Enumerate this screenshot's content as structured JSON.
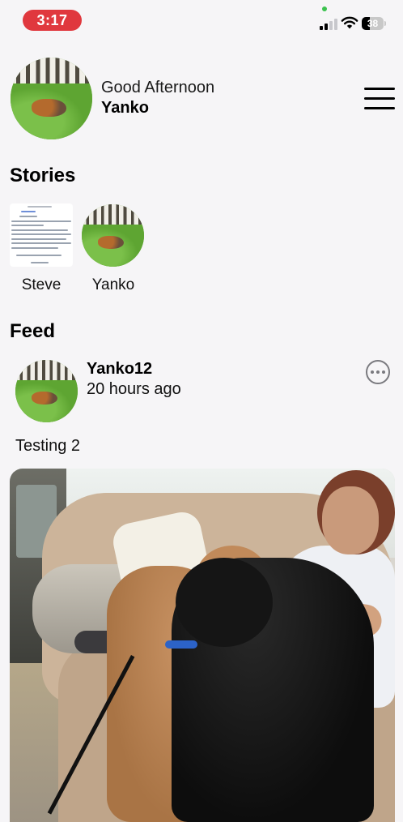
{
  "status_bar": {
    "time": "3:17",
    "battery_percent": "38",
    "battery_level": 0.38,
    "signal_bars": 2,
    "colors": {
      "time_pill": "#e0383e",
      "privacy_dot": "#3cc24f"
    }
  },
  "header": {
    "greeting": "Good Afternoon",
    "username": "Yanko",
    "menu_icon": "hamburger-menu-icon"
  },
  "stories": {
    "title": "Stories",
    "items": [
      {
        "name": "Steve"
      },
      {
        "name": "Yanko"
      }
    ]
  },
  "feed": {
    "title": "Feed",
    "post": {
      "username": "Yanko12",
      "time": "20 hours ago",
      "caption": "Testing 2",
      "more_icon": "ellipsis-circle-icon"
    }
  }
}
